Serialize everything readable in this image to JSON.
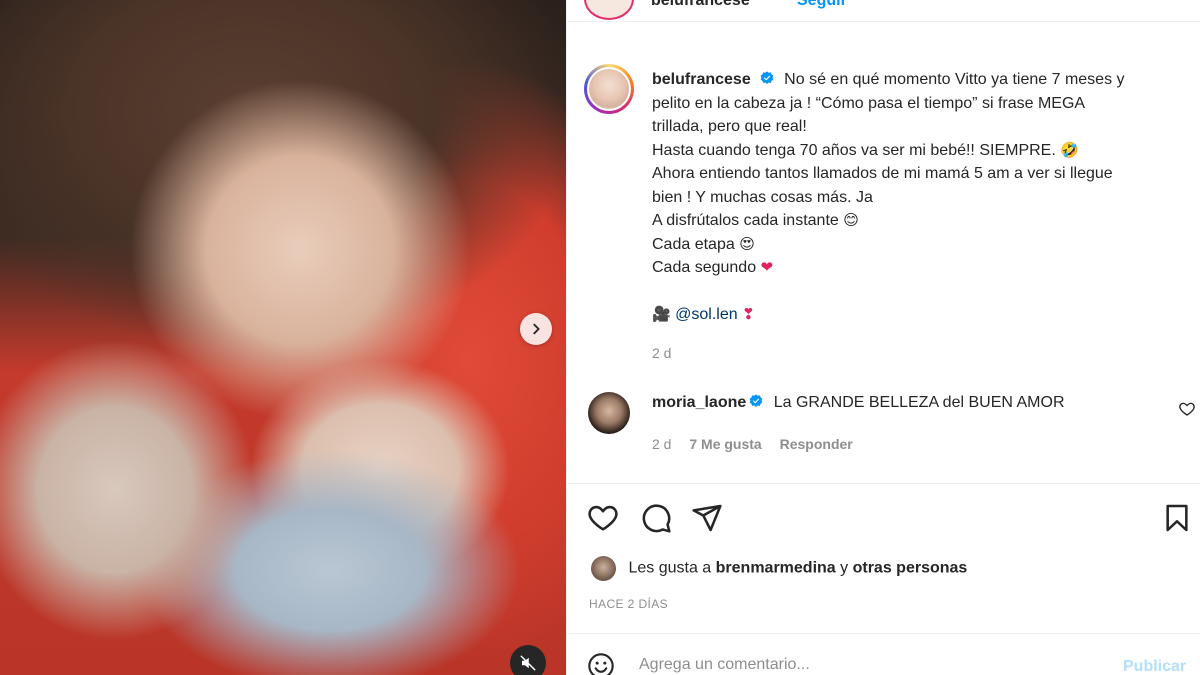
{
  "post": {
    "username": "belufrancese",
    "follow_label": "Seguir"
  },
  "caption": {
    "username": "belufrancese",
    "lines": [
      "No sé en qué momento Vitto ya tiene 7 meses y",
      "pelito en la cabeza ja ! “Cómo pasa el tiempo” si frase MEGA",
      "trillada, pero que real!",
      "Hasta cuando tenga 70 años va ser mi bebé!! SIEMPRE.",
      "Ahora entiendo tantos llamados de mi mamá 5 am a ver si llegue",
      "bien ! Y muchas cosas más. Ja",
      "A disfrútalos cada instante",
      "Cada etapa",
      "Cada segundo"
    ],
    "emojis": {
      "laugh": "🤣",
      "smile": "😊",
      "heart_eyes": "😍",
      "heart": "❤",
      "camera_person": "🎥",
      "heart_exclaim": "❣"
    },
    "mention": "@sol.len",
    "time": "2 d"
  },
  "comment": {
    "username": "moria_laone",
    "text": "La GRANDE BELLEZA del BUEN AMOR",
    "time": "2 d",
    "likes": "7 Me gusta",
    "reply_label": "Responder"
  },
  "likes": {
    "prefix": "Les gusta a",
    "user": "brenmarmedina",
    "connector": "y",
    "others": "otras personas"
  },
  "posted_ago": "HACE 2 DÍAS",
  "add_comment": {
    "placeholder": "Agrega un comentario...",
    "publish_label": "Publicar"
  },
  "colors": {
    "link_blue": "#0095f6",
    "publish_disabled": "#b2dffc",
    "verified": "#0095f6",
    "heart_red": "#e0245e"
  }
}
